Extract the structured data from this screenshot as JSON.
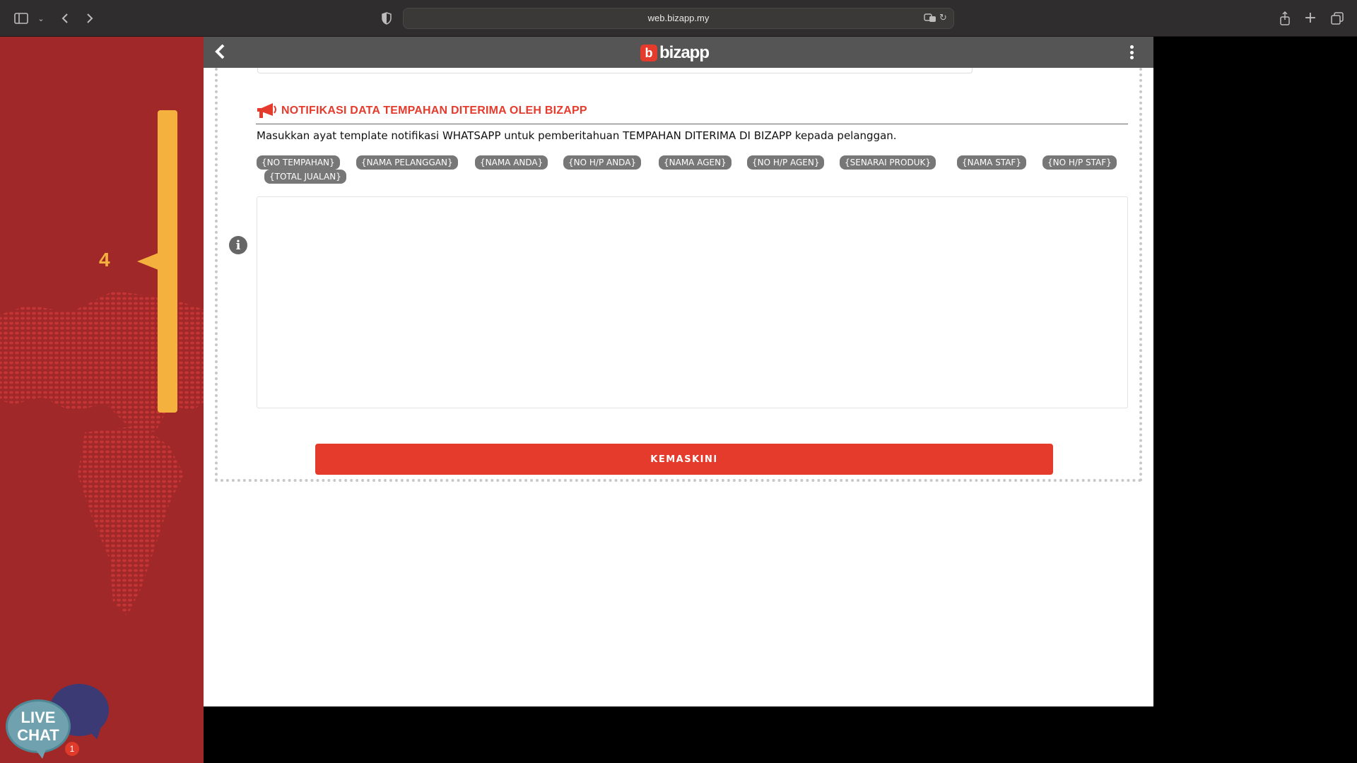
{
  "browser": {
    "url": "web.bizapp.my"
  },
  "left_panel": {
    "step_number": "4"
  },
  "live_chat": {
    "line1": "LIVE",
    "line2": "CHAT",
    "badge_count": "1"
  },
  "app": {
    "logo_mark": "b",
    "logo_text": "bizapp",
    "section": {
      "title": "NOTIFIKASI DATA TEMPAHAN DITERIMA OLEH BIZAPP",
      "description": "Masukkan ayat template notifikasi WHATSAPP untuk pemberitahuan TEMPAHAN DITERIMA DI BIZAPP kepada pelanggan.",
      "tags": [
        "{NO TEMPAHAN}",
        "{NAMA PELANGGAN}",
        "{NAMA ANDA}",
        "{NO H/P ANDA}",
        "{NAMA AGEN}",
        "{NO H/P AGEN}",
        "{SENARAI PRODUK}",
        "{NAMA STAF}",
        "{NO H/P STAF}",
        "{TOTAL JUALAN}"
      ],
      "template_value": ""
    },
    "update_button": "KEMASKINI"
  },
  "colors": {
    "brand_red": "#e53b2c",
    "panel_red": "#a12828",
    "step_yellow": "#f5b13d",
    "header_gray": "#555555"
  }
}
